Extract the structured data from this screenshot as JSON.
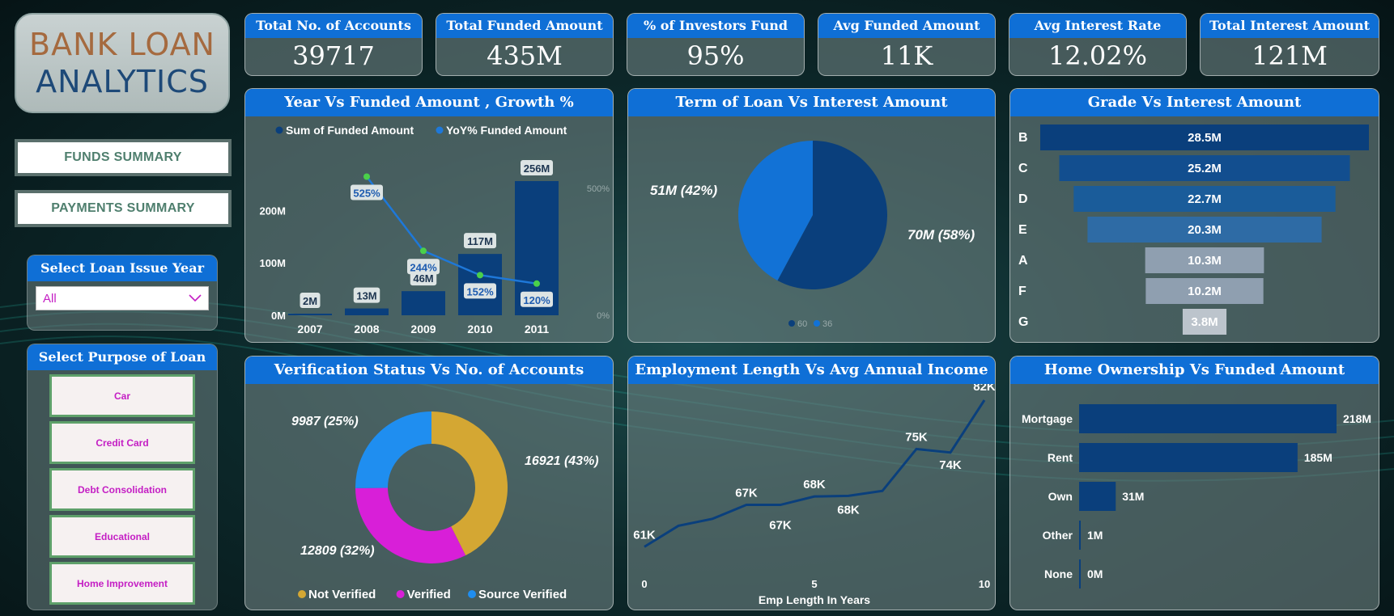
{
  "logo": {
    "line1": "BANK LOAN",
    "line2": "ANALYTICS"
  },
  "nav": {
    "funds_summary": "FUNDS SUMMARY",
    "payments_summary": "PAYMENTS SUMMARY"
  },
  "year_slicer": {
    "title": "Select Loan Issue Year",
    "value": "All",
    "icon": "chevron-down-icon"
  },
  "purpose_slicer": {
    "title": "Select Purpose of Loan",
    "items": [
      "Car",
      "Credit Card",
      "Debt Consolidation",
      "Educational",
      "Home Improvement"
    ]
  },
  "kpis": [
    {
      "label": "Total No. of Accounts",
      "value": "39717"
    },
    {
      "label": "Total Funded Amount",
      "value": "435M"
    },
    {
      "label": "% of Investors Fund",
      "value": "95%"
    },
    {
      "label": "Avg Funded Amount",
      "value": "11K"
    },
    {
      "label": "Avg Interest Rate",
      "value": "12.02%"
    },
    {
      "label": "Total Interest Amount",
      "value": "121M"
    }
  ],
  "colors": {
    "accent": "#0f6fd6",
    "bar_dark": "#0a3f7c",
    "line": "#1e78d9",
    "gold": "#d4a733",
    "magenta": "#d81fd8",
    "sky": "#1f8ef0"
  },
  "chart_data": [
    {
      "type": "bar",
      "title": "Year Vs Funded Amount , Growth %",
      "legend": [
        "Sum of Funded Amount",
        "YoY% Funded Amount"
      ],
      "categories": [
        "2007",
        "2008",
        "2009",
        "2010",
        "2011"
      ],
      "series": [
        {
          "name": "Sum of Funded Amount",
          "values": [
            2,
            13,
            46,
            117,
            256
          ],
          "labels": [
            "2M",
            "13M",
            "46M",
            "117M",
            "256M"
          ]
        },
        {
          "name": "YoY% Funded Amount",
          "values": [
            null,
            525,
            244,
            152,
            120
          ],
          "labels": [
            "",
            "525%",
            "244%",
            "152%",
            "120%"
          ]
        }
      ],
      "y_ticks": [
        "0M",
        "100M",
        "200M"
      ],
      "y2_ticks": [
        "0%",
        "500%"
      ],
      "ylim": [
        0,
        256
      ]
    },
    {
      "type": "pie",
      "title": "Term of Loan Vs Interest Amount",
      "slices": [
        {
          "name": "60",
          "value": 70,
          "label": "70M (58%)"
        },
        {
          "name": "36",
          "value": 51,
          "label": "51M (42%)"
        }
      ],
      "legend": [
        "60",
        "36"
      ]
    },
    {
      "type": "bar",
      "title": "Grade Vs Interest Amount",
      "categories": [
        "B",
        "C",
        "D",
        "E",
        "A",
        "F",
        "G"
      ],
      "values": [
        28.5,
        25.2,
        22.7,
        20.3,
        10.3,
        10.2,
        3.8
      ],
      "labels": [
        "28.5M",
        "25.2M",
        "22.7M",
        "20.3M",
        "10.3M",
        "10.2M",
        "3.8M"
      ]
    },
    {
      "type": "pie",
      "title": "Verification Status Vs No. of Accounts",
      "slices": [
        {
          "name": "Not Verified",
          "value": 16921,
          "label": "16921 (43%)"
        },
        {
          "name": "Verified",
          "value": 12809,
          "label": "12809 (32%)"
        },
        {
          "name": "Source Verified",
          "value": 9987,
          "label": "9987 (25%)"
        }
      ],
      "legend": [
        "Not Verified",
        "Verified",
        "Source Verified"
      ]
    },
    {
      "type": "line",
      "title": "Employment Length Vs Avg Annual Income",
      "x": [
        0,
        1,
        2,
        3,
        4,
        5,
        6,
        7,
        8,
        9,
        10
      ],
      "values": [
        61,
        64,
        65,
        67,
        67,
        68.2,
        68.3,
        69,
        75,
        74.5,
        82
      ],
      "point_labels": [
        "61K",
        "",
        "",
        "67K",
        "67K",
        "68K",
        "68K",
        "",
        "75K",
        "74K",
        "82K"
      ],
      "x_ticks": [
        "0",
        "5",
        "10"
      ],
      "xlabel": "Emp Length In Years"
    },
    {
      "type": "bar",
      "title": "Home Ownership Vs Funded Amount",
      "categories": [
        "Mortgage",
        "Rent",
        "Own",
        "Other",
        "None"
      ],
      "values": [
        218,
        185,
        31,
        1,
        0
      ],
      "labels": [
        "218M",
        "185M",
        "31M",
        "1M",
        "0M"
      ]
    }
  ]
}
